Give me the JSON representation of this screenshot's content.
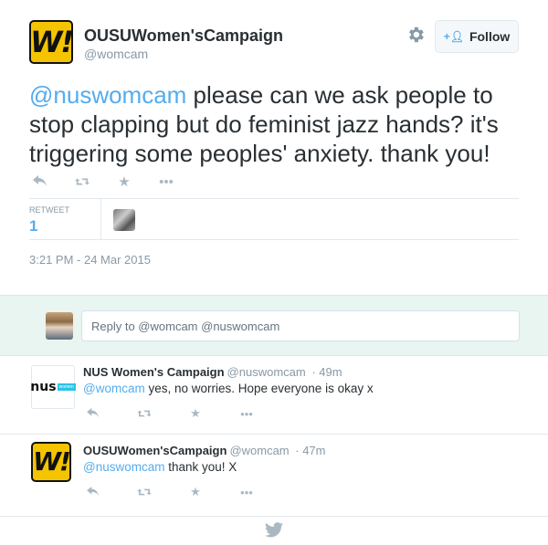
{
  "tweet": {
    "author_name": "OUSUWomen'sCampaign",
    "author_handle": "@womcam",
    "avatar_text": "W!",
    "follow_label": "Follow",
    "text_mention": "@nuswomcam",
    "text_body": " please can we ask people to stop clapping but do feminist jazz hands? it's triggering some peoples' anxiety. thank you!",
    "retweet_label": "RETWEET",
    "retweet_count": "1",
    "timestamp": "3:21 PM - 24 Mar 2015"
  },
  "reply_box": {
    "placeholder": "Reply to @womcam @nuswomcam"
  },
  "replies": [
    {
      "name": "NUS Women's Campaign",
      "handle": "@nuswomcam",
      "time": "· 49m",
      "mention": "@womcam",
      "text": " yes, no worries. Hope everyone is okay x",
      "avatar_text": "nus",
      "avatar_badge": "women"
    },
    {
      "name": "OUSUWomen'sCampaign",
      "handle": "@womcam",
      "time": "· 47m",
      "mention": "@nuswomcam",
      "text": " thank you! X",
      "avatar_text": "W!"
    }
  ],
  "icons": {
    "reply": "reply-icon",
    "retweet": "retweet-icon",
    "favorite": "star-icon",
    "more": "more-icon",
    "settings": "gear-icon",
    "follow": "add-user-icon",
    "brand": "twitter-bird-icon"
  },
  "colors": {
    "accent": "#55acee",
    "brand_yellow": "#f5c400",
    "reply_bg": "#e8f5f0",
    "muted": "#8899a6"
  }
}
